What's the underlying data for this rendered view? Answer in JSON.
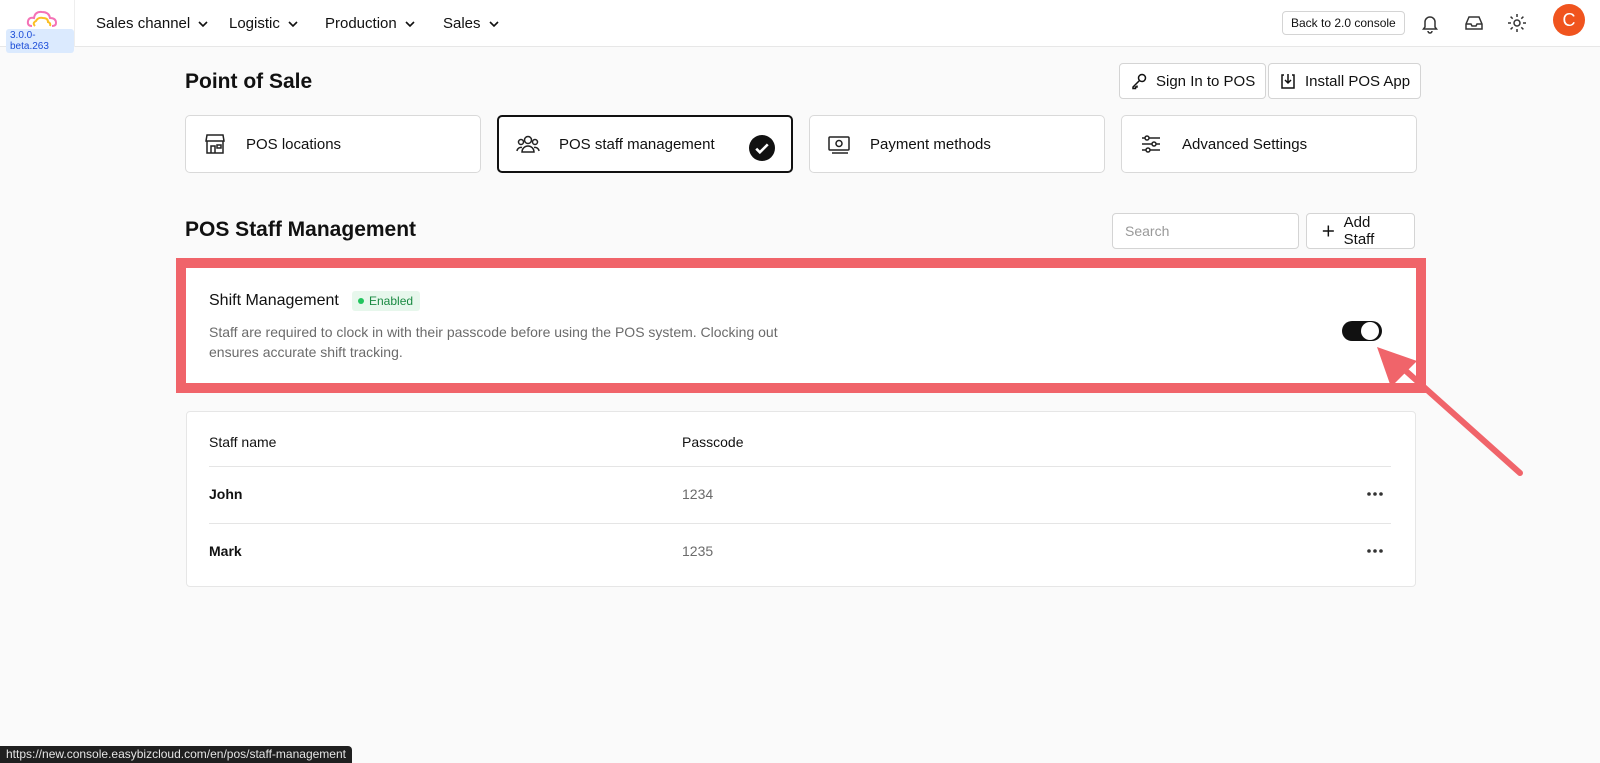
{
  "app": {
    "version": "3.0.0-beta.263"
  },
  "nav": {
    "items": [
      {
        "label": "Sales channel"
      },
      {
        "label": "Logistic"
      },
      {
        "label": "Production"
      },
      {
        "label": "Sales"
      }
    ],
    "back_label": "Back to 2.0 console",
    "avatar_initial": "C",
    "avatar_color": "#f0541e"
  },
  "page": {
    "title": "Point of Sale",
    "sign_in_label": "Sign In to POS",
    "install_label": "Install POS App"
  },
  "tabs": [
    {
      "label": "POS locations",
      "icon": "store-icon",
      "active": false
    },
    {
      "label": "POS staff management",
      "icon": "users-icon",
      "active": true
    },
    {
      "label": "Payment methods",
      "icon": "cash-icon",
      "active": false
    },
    {
      "label": "Advanced Settings",
      "icon": "sliders-icon",
      "active": false
    }
  ],
  "section": {
    "title": "POS Staff Management",
    "search_placeholder": "Search",
    "add_label": "Add Staff"
  },
  "shift": {
    "title": "Shift Management",
    "badge": "Enabled",
    "description": "Staff are required to clock in with their passcode before using the POS system. Clocking out ensures accurate shift tracking.",
    "enabled": true,
    "highlight_color": "#f0646a"
  },
  "table": {
    "headers": [
      "Staff name",
      "Passcode"
    ],
    "rows": [
      {
        "name": "John",
        "passcode": "1234"
      },
      {
        "name": "Mark",
        "passcode": "1235"
      }
    ]
  },
  "statusbar": {
    "url": "https://new.console.easybizcloud.com/en/pos/staff-management"
  }
}
